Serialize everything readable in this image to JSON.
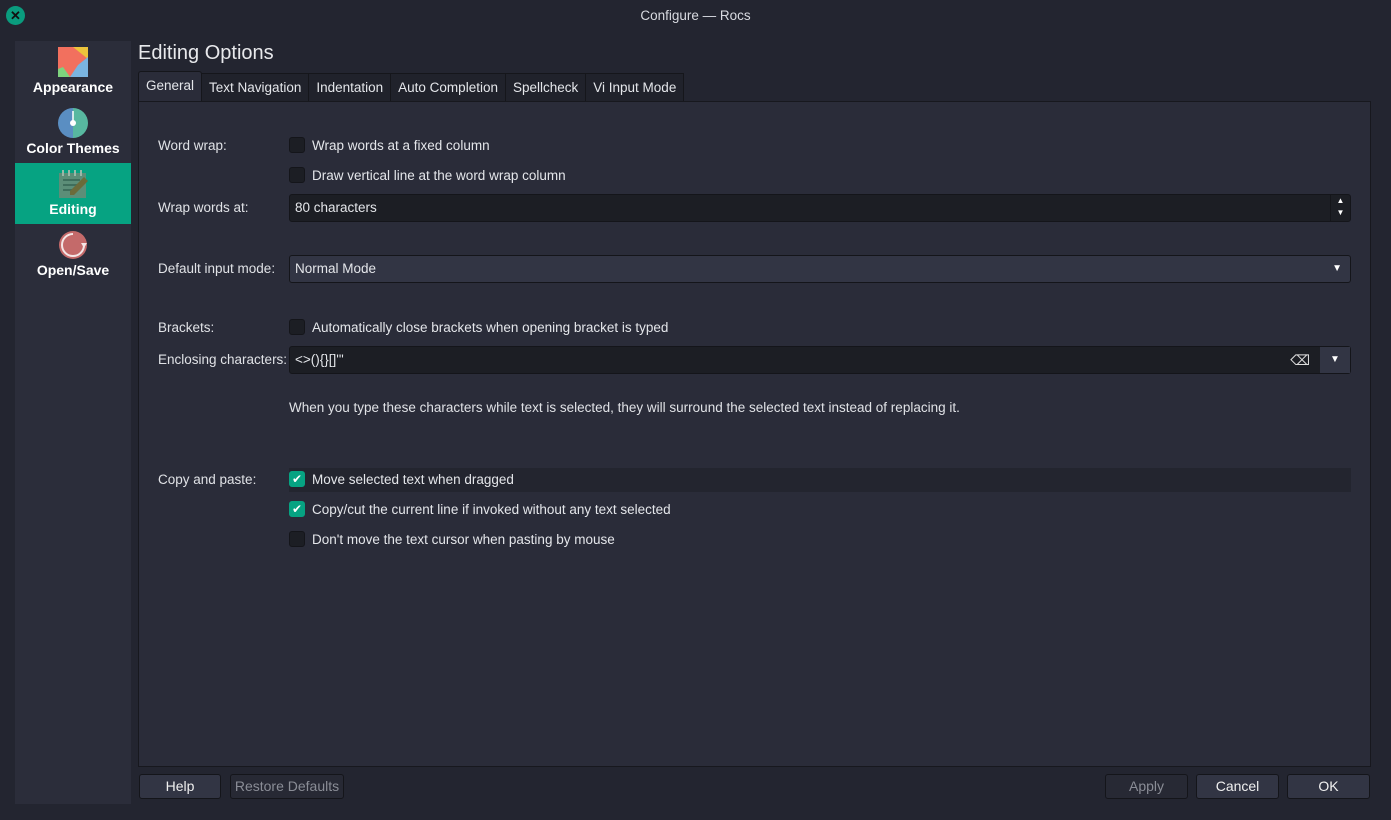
{
  "window": {
    "title": "Configure — Rocs"
  },
  "sidebar": {
    "items": [
      {
        "label": "Appearance",
        "icon": "appearance-icon"
      },
      {
        "label": "Color Themes",
        "icon": "color-themes-icon"
      },
      {
        "label": "Editing",
        "icon": "editing-icon",
        "active": true
      },
      {
        "label": "Open/Save",
        "icon": "open-save-icon"
      }
    ]
  },
  "page": {
    "title": "Editing Options"
  },
  "tabs": [
    "General",
    "Text Navigation",
    "Indentation",
    "Auto Completion",
    "Spellcheck",
    "Vi Input Mode"
  ],
  "general": {
    "word_wrap_label": "Word wrap:",
    "wrap_fixed": {
      "label": "Wrap words at a fixed column",
      "checked": false
    },
    "draw_line": {
      "label": "Draw vertical line at the word wrap column",
      "checked": false
    },
    "wrap_at_label": "Wrap words at:",
    "wrap_at_value": "80 characters",
    "input_mode_label": "Default input mode:",
    "input_mode_value": "Normal Mode",
    "brackets_label": "Brackets:",
    "auto_close": {
      "label": "Automatically close brackets when opening bracket is typed",
      "checked": false
    },
    "enclosing_label": "Enclosing characters:",
    "enclosing_value": "<>(){}[]'\"",
    "enclosing_note": "When you type these characters while text is selected, they will surround the selected text instead of replacing it.",
    "copy_paste_label": "Copy and paste:",
    "move_selected": {
      "label": "Move selected text when dragged",
      "checked": true
    },
    "copy_cut_line": {
      "label": "Copy/cut the current line if invoked without any text selected",
      "checked": true
    },
    "no_move_cursor": {
      "label": "Don't move the text cursor when pasting by mouse",
      "checked": false
    }
  },
  "buttons": {
    "help": "Help",
    "restore": "Restore Defaults",
    "apply": "Apply",
    "cancel": "Cancel",
    "ok": "OK"
  },
  "colors": {
    "accent": "#06a382"
  }
}
